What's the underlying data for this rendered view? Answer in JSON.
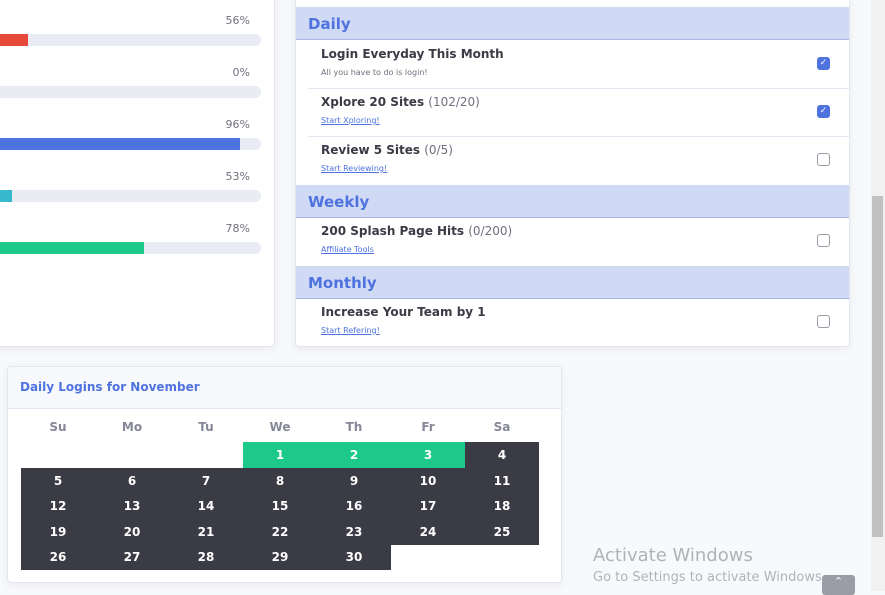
{
  "progress": [
    {
      "percent": "56%",
      "value": 56,
      "color": "#e74a3b"
    },
    {
      "percent": "0%",
      "value": 0,
      "color": "#f6c23e"
    },
    {
      "percent": "96%",
      "value": 96,
      "color": "#4e73df"
    },
    {
      "percent": "53%",
      "value": 53,
      "color": "#36b9cc"
    },
    {
      "percent": "78%",
      "value": 78,
      "color": "#1cc88a"
    }
  ],
  "achievements": {
    "daily_label": "Daily",
    "weekly_label": "Weekly",
    "monthly_label": "Monthly",
    "daily": [
      {
        "title": "Login Everyday This Month",
        "count": "",
        "sub": "All you have to do is login!",
        "link": false,
        "checked": true
      },
      {
        "title": "Xplore 20 Sites",
        "count": "(102/20)",
        "sub": "Start Xploring!",
        "link": true,
        "checked": true
      },
      {
        "title": "Review 5 Sites",
        "count": "(0/5)",
        "sub": "Start Reviewing!",
        "link": true,
        "checked": false
      }
    ],
    "weekly": [
      {
        "title": "200 Splash Page Hits",
        "count": "(0/200)",
        "sub": "Affiliate Tools",
        "link": true,
        "checked": false
      }
    ],
    "monthly": [
      {
        "title": "Increase Your Team by 1",
        "count": "",
        "sub": "Start Refering!",
        "link": true,
        "checked": false
      }
    ]
  },
  "calendar": {
    "title": "Daily Logins for November",
    "weekdays": [
      "Su",
      "Mo",
      "Tu",
      "We",
      "Th",
      "Fr",
      "Sa"
    ],
    "first_weekday": 3,
    "days": 30,
    "logged_days": [
      1,
      2,
      3
    ],
    "colors": {
      "logged": "#1cc88a",
      "other": "#3a3b45"
    }
  },
  "watermark": {
    "title": "Activate Windows",
    "subtitle": "Go to Settings to activate Windows."
  }
}
